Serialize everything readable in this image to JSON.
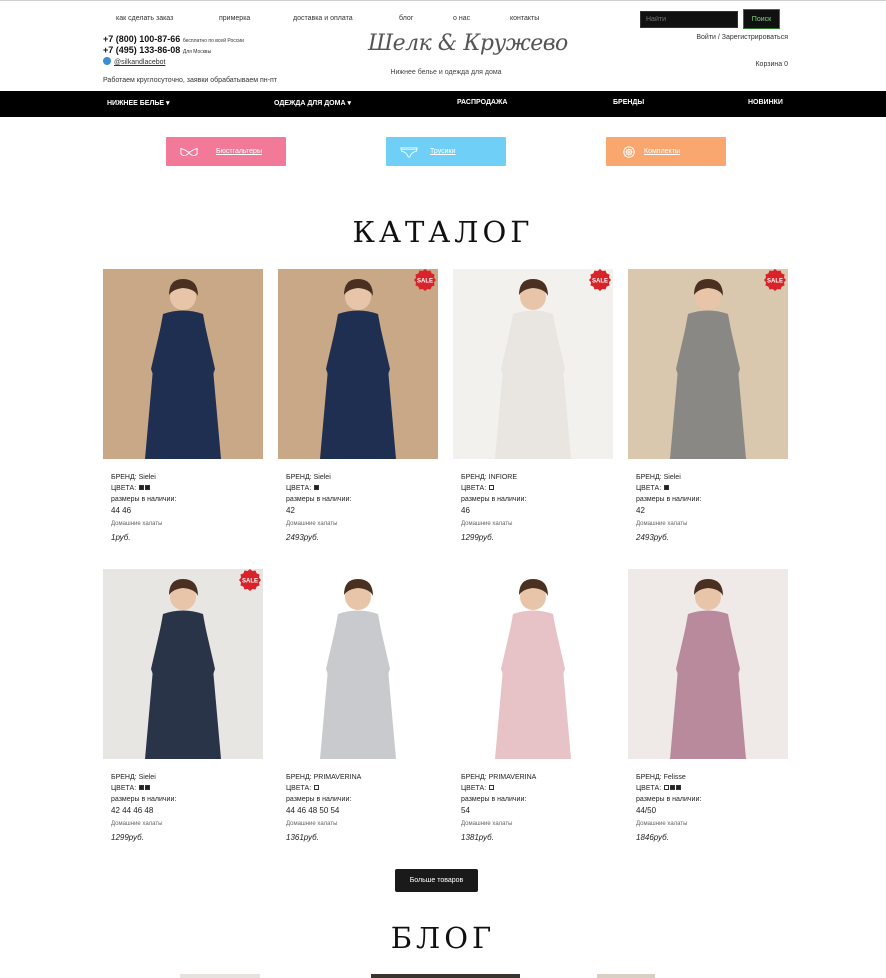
{
  "top_links": [
    "как сделать заказ",
    "примерка",
    "доставка и оплата",
    "блог",
    "о нас",
    "контакты"
  ],
  "search": {
    "placeholder": "Найти",
    "button": "Поиск"
  },
  "contacts": {
    "phone1": "+7 (800) 100-87-66",
    "phone1_note": "бесплатно по всей России",
    "phone2": "+7 (495) 133-86-08",
    "phone2_note": "Для Москвы",
    "telegram": "@silkandlacebot",
    "hours": "Работаем круглосуточно, заявки обрабатываем пн-пт"
  },
  "brand": {
    "logo": "Шелк & Кружево",
    "tagline": "Нижнее белье и одежда для дома"
  },
  "account": {
    "login": "Войти",
    "separator": "/",
    "register": "Зарегистрироваться",
    "cart": "Корзина 0"
  },
  "nav": [
    "НИЖНЕЕ БЕЛЬЕ ▾",
    "ОДЕЖДА ДЛЯ ДОМА ▾",
    "РАСПРОДАЖА",
    "БРЕНДЫ",
    "НОВИНКИ"
  ],
  "categories": [
    {
      "label": "Бюстгальтеры",
      "icon": "bra-icon",
      "color": "#f27a98"
    },
    {
      "label": "Трусики",
      "icon": "panties-icon",
      "color": "#6fcff6"
    },
    {
      "label": "Комплекты",
      "icon": "lace-set-icon",
      "color": "#f9a66f"
    }
  ],
  "catalog": {
    "title": "КАТАЛОГ",
    "sale_badge": "SALE",
    "labels": {
      "brand": "БРЕНД: ",
      "colors": "ЦВЕТА: ",
      "sizes": "размеры в наличии:"
    },
    "products": [
      {
        "brand": "Sielei",
        "swatches": [
          "dark",
          "dark"
        ],
        "sizes": "44  46",
        "category": "Домашние халаты",
        "price": "1",
        "currency": "руб.",
        "sale": false,
        "dress": "#1f2f52",
        "bg": "#c9a888"
      },
      {
        "brand": "Sielei",
        "swatches": [
          "dark"
        ],
        "sizes": "42",
        "category": "Домашние халаты",
        "price": "2493",
        "currency": "руб.",
        "sale": true,
        "dress": "#1f2f52",
        "bg": "#c9a888"
      },
      {
        "brand": "INFIORE",
        "swatches": [
          "light"
        ],
        "sizes": "46",
        "category": "Домашние халаты",
        "price": "1299",
        "currency": "руб.",
        "sale": true,
        "dress": "#e9e6e1",
        "bg": "#f3f1ee"
      },
      {
        "brand": "Sielei",
        "swatches": [
          "dark"
        ],
        "sizes": "42",
        "category": "Домашние халаты",
        "price": "2493",
        "currency": "руб.",
        "sale": true,
        "dress": "#8a8884",
        "bg": "#d9c7ae"
      },
      {
        "brand": "Sielei",
        "swatches": [
          "dark",
          "dark"
        ],
        "sizes": "42  44  46  48",
        "category": "Домашние халаты",
        "price": "1299",
        "currency": "руб.",
        "sale": true,
        "dress": "#2a3448",
        "bg": "#e8e6e3"
      },
      {
        "brand": "PRIMAVERINA",
        "swatches": [
          "light"
        ],
        "sizes": "44  46  48  50  54",
        "category": "Домашние халаты",
        "price": "1361",
        "currency": "руб.",
        "sale": false,
        "dress": "#c8cacd",
        "bg": "#ffffff"
      },
      {
        "brand": "PRIMAVERINA",
        "swatches": [
          "light"
        ],
        "sizes": "54",
        "category": "Домашние халаты",
        "price": "1381",
        "currency": "руб.",
        "sale": false,
        "dress": "#e7c2c6",
        "bg": "#ffffff"
      },
      {
        "brand": "Felisse",
        "swatches": [
          "light",
          "dark",
          "dark"
        ],
        "sizes": "44/50",
        "category": "Домашние халаты",
        "price": "1846",
        "currency": "руб.",
        "sale": false,
        "dress": "#b98a9c",
        "bg": "#efeae8"
      }
    ]
  },
  "more_button": "Больше товаров",
  "blog": {
    "title": "БЛОГ"
  }
}
